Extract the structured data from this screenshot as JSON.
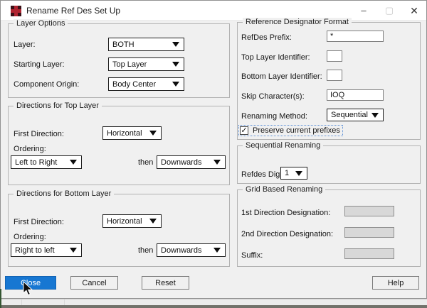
{
  "window": {
    "title": "Rename Ref Des Set Up",
    "controls": {
      "minimize": "–",
      "maximize": "▢",
      "close": "✕"
    }
  },
  "icons": {
    "check": "✓"
  },
  "colors": {
    "accent_button": "#1777d2",
    "dialog_bg": "#f0f0f0",
    "titlebar_bg": "#ffffff",
    "app_icon_red": "#b02430"
  },
  "layer_options": {
    "title": "Layer Options",
    "layer_label": "Layer:",
    "layer_value": "BOTH",
    "starting_layer_label": "Starting Layer:",
    "starting_layer_value": "Top Layer",
    "component_origin_label": "Component Origin:",
    "component_origin_value": "Body Center"
  },
  "directions_top": {
    "title": "Directions for Top Layer",
    "first_direction_label": "First Direction:",
    "first_direction_value": "Horizontal",
    "ordering_label": "Ordering:",
    "ordering_value": "Left to Right",
    "then_label": "then",
    "then_value": "Downwards"
  },
  "directions_bottom": {
    "title": "Directions for Bottom Layer",
    "first_direction_label": "First Direction:",
    "first_direction_value": "Horizontal",
    "ordering_label": "Ordering:",
    "ordering_value": "Right to left",
    "then_label": "then",
    "then_value": "Downwards"
  },
  "ref_des_format": {
    "title": "Reference Designator Format",
    "refdes_prefix_label": "RefDes Prefix:",
    "refdes_prefix_value": "*",
    "top_layer_id_label": "Top Layer Identifier:",
    "top_layer_id_value": "",
    "bottom_layer_id_label": "Bottom Layer Identifier:",
    "bottom_layer_id_value": "",
    "skip_chars_label": "Skip Character(s):",
    "skip_chars_value": "IOQ",
    "renaming_method_label": "Renaming Method:",
    "renaming_method_value": "Sequential",
    "preserve_prefixes_label": "Preserve current prefixes",
    "preserve_prefixes_checked": true
  },
  "sequential_renaming": {
    "title": "Sequential Renaming",
    "refdes_digits_label": "Refdes Digits:",
    "refdes_digits_value": "1"
  },
  "grid_renaming": {
    "title": "Grid Based Renaming",
    "first_designation_label": "1st Direction Designation:",
    "first_designation_value": "",
    "second_designation_label": "2nd Direction Designation:",
    "second_designation_value": "",
    "suffix_label": "Suffix:",
    "suffix_value": ""
  },
  "buttons": {
    "close": "Close",
    "cancel": "Cancel",
    "reset": "Reset",
    "help": "Help"
  }
}
